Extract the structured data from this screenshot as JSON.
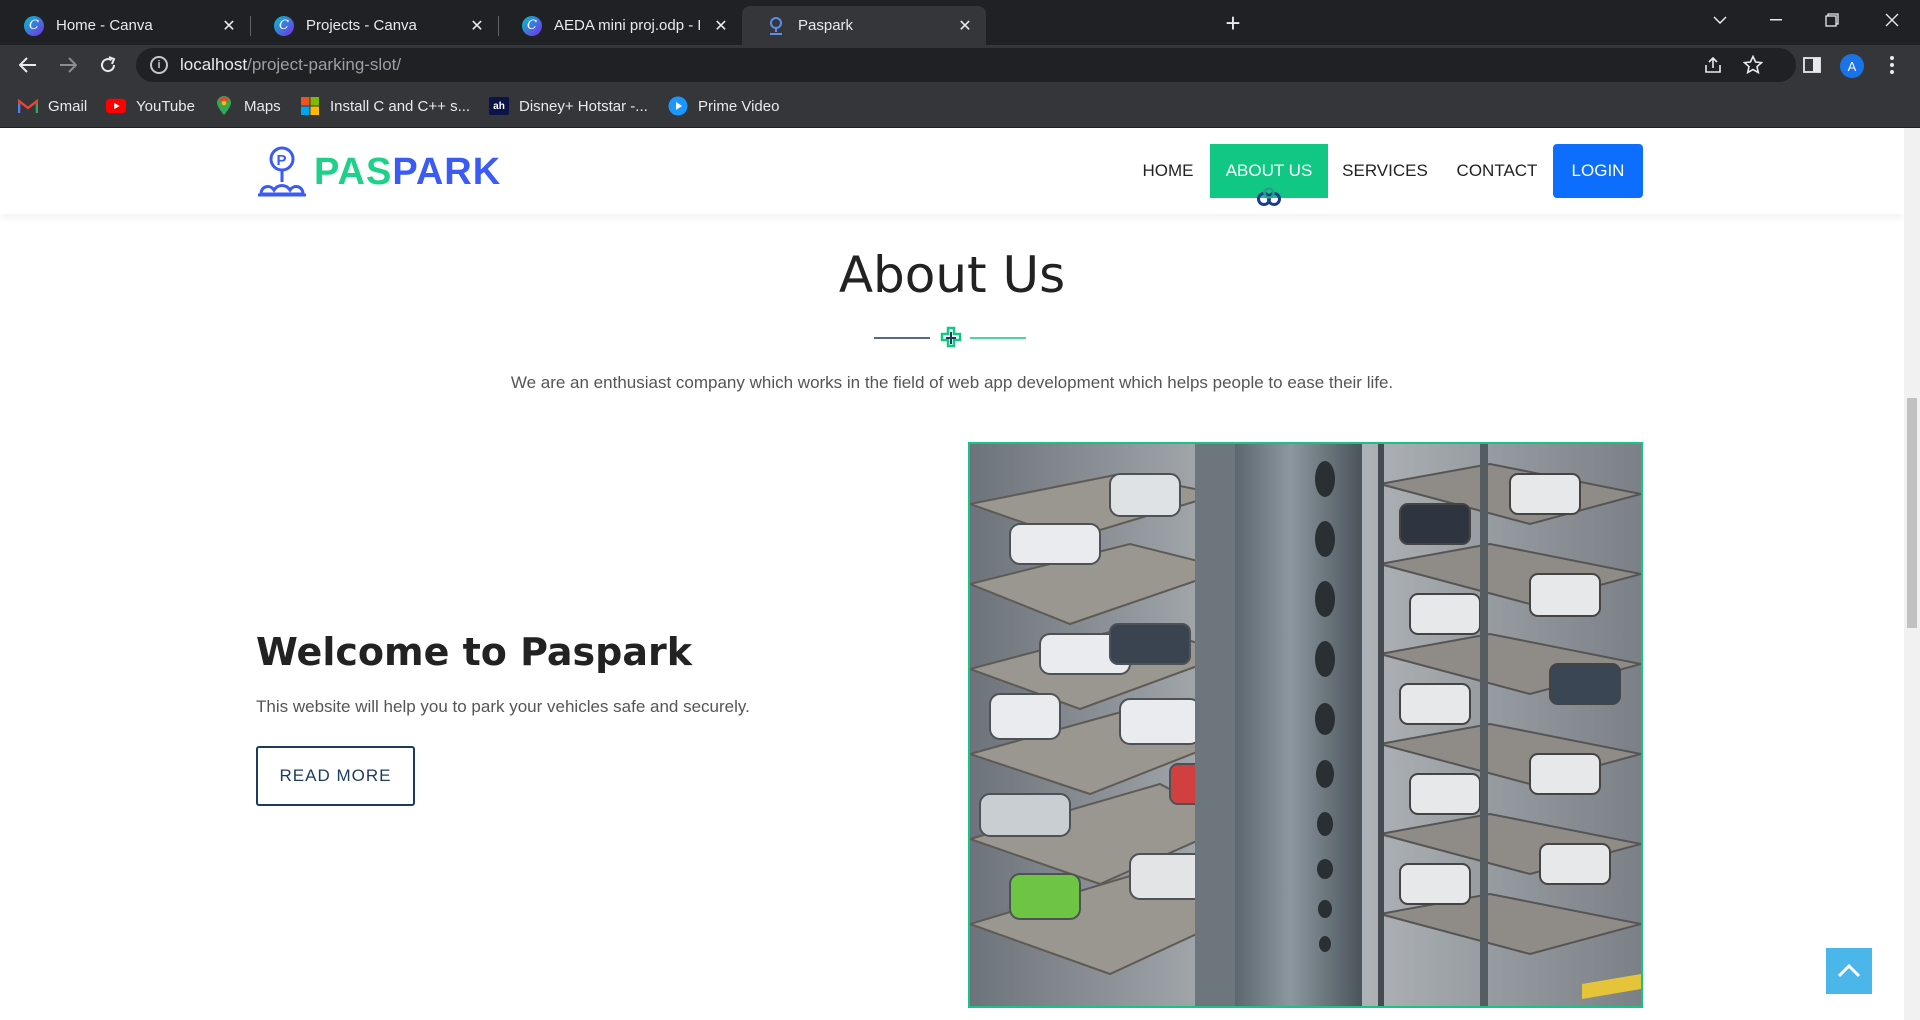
{
  "browser": {
    "tabs": [
      {
        "title": "Home - Canva",
        "favicon": "canva-icon",
        "active": false
      },
      {
        "title": "Projects - Canva",
        "favicon": "canva-icon",
        "active": false
      },
      {
        "title": "AEDA mini proj.odp - Presentatio",
        "favicon": "canva-icon",
        "active": false
      },
      {
        "title": "Paspark",
        "favicon": "location-pin-icon",
        "active": true
      }
    ],
    "canva_glyph": "C",
    "close_glyph": "✕",
    "new_tab_glyph": "+",
    "url_host": "localhost",
    "url_path": "/project-parking-slot/",
    "profile_initial": "A",
    "bookmarks": [
      {
        "label": "Gmail",
        "icon": "gmail-icon"
      },
      {
        "label": "YouTube",
        "icon": "youtube-icon"
      },
      {
        "label": "Maps",
        "icon": "maps-icon"
      },
      {
        "label": "Install C and C++ s...",
        "icon": "microsoft-icon"
      },
      {
        "label": "Disney+ Hotstar -...",
        "icon": "hotstar-icon",
        "glyph": "ah"
      },
      {
        "label": "Prime Video",
        "icon": "prime-video-icon"
      }
    ]
  },
  "site": {
    "logo": {
      "part1": "PAS",
      "part2": "PARK",
      "mark_letter": "P"
    },
    "nav": {
      "home": "HOME",
      "about": "ABOUT US",
      "services": "SERVICES",
      "contact": "CONTACT",
      "login": "LOGIN"
    },
    "about": {
      "title": "About Us",
      "lead": "We are an enthusiast company which works in the field of web app development which helps people to ease their life."
    },
    "welcome": {
      "title": "Welcome to Paspark",
      "text": "This website will help you to park your vehicles safe and securely.",
      "button": "READ MORE"
    }
  },
  "colors": {
    "brand_green": "#10c883",
    "brand_blue": "#3b5bf5",
    "login_blue": "#0d6efd",
    "button_navy": "#1c3b5e",
    "to_top_blue": "#4bb6ea"
  }
}
